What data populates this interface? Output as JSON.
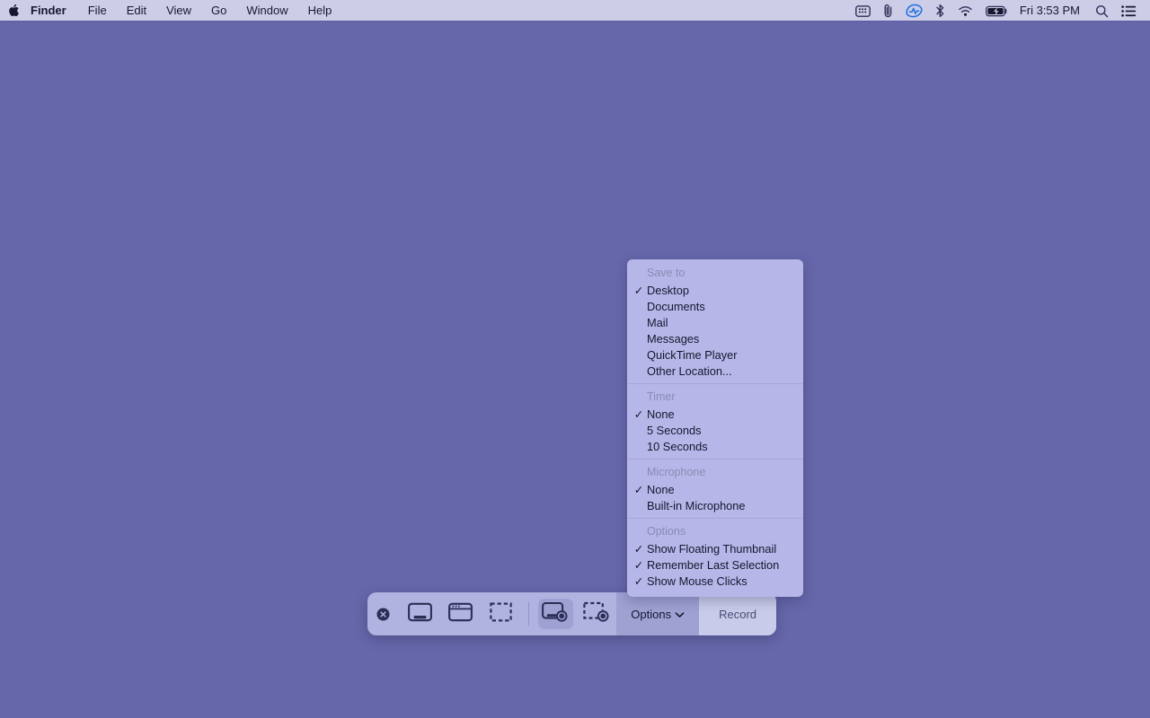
{
  "menubar": {
    "apple_icon": "apple-logo-icon",
    "app_name": "Finder",
    "menus": [
      {
        "label": "File"
      },
      {
        "label": "Edit"
      },
      {
        "label": "View"
      },
      {
        "label": "Go"
      },
      {
        "label": "Window"
      },
      {
        "label": "Help"
      }
    ],
    "status_icons": [
      {
        "name": "screen-mirroring-icon"
      },
      {
        "name": "paperclip-icon"
      },
      {
        "name": "activity-monitor-icon"
      },
      {
        "name": "bluetooth-icon"
      },
      {
        "name": "wifi-icon"
      },
      {
        "name": "battery-charging-icon"
      }
    ],
    "clock": "Fri 3:53 PM",
    "search_icon": "search-icon",
    "control_center_icon": "control-center-icon"
  },
  "options_menu": {
    "sections": [
      {
        "header": "Save to",
        "items": [
          {
            "label": "Desktop",
            "checked": true
          },
          {
            "label": "Documents",
            "checked": false
          },
          {
            "label": "Mail",
            "checked": false
          },
          {
            "label": "Messages",
            "checked": false
          },
          {
            "label": "QuickTime Player",
            "checked": false
          },
          {
            "label": "Other Location...",
            "checked": false
          }
        ]
      },
      {
        "header": "Timer",
        "items": [
          {
            "label": "None",
            "checked": true
          },
          {
            "label": "5 Seconds",
            "checked": false
          },
          {
            "label": "10 Seconds",
            "checked": false
          }
        ]
      },
      {
        "header": "Microphone",
        "items": [
          {
            "label": "None",
            "checked": true
          },
          {
            "label": "Built-in Microphone",
            "checked": false
          }
        ]
      },
      {
        "header": "Options",
        "items": [
          {
            "label": "Show Floating Thumbnail",
            "checked": true
          },
          {
            "label": "Remember Last Selection",
            "checked": true
          },
          {
            "label": "Show Mouse Clicks",
            "checked": true
          }
        ]
      }
    ],
    "checkmark_glyph": "✓"
  },
  "toolbar": {
    "close_icon": "close-circle-icon",
    "capture_buttons": [
      {
        "name": "capture-entire-screen",
        "icon": "display-icon",
        "selected": false
      },
      {
        "name": "capture-selected-window",
        "icon": "window-icon",
        "selected": false
      },
      {
        "name": "capture-selected-portion",
        "icon": "dashed-rectangle-icon",
        "selected": false
      }
    ],
    "record_buttons": [
      {
        "name": "record-entire-screen",
        "icon": "display-record-icon",
        "selected": true
      },
      {
        "name": "record-selected-portion",
        "icon": "dashed-record-icon",
        "selected": false
      }
    ],
    "options_label": "Options",
    "options_chevron": "chevron-down-icon",
    "record_label": "Record"
  },
  "colors": {
    "desktop_background": "#6667ab",
    "menubar_background": "#cdcde8",
    "menu_panel_background": "#b6b7e8",
    "toolbar_background": "#b0b2e0",
    "record_button_background": "#c9cbea",
    "selected_button_background": "#9fa1d3",
    "text_primary": "#16162e",
    "text_muted": "#8a8ab5"
  }
}
